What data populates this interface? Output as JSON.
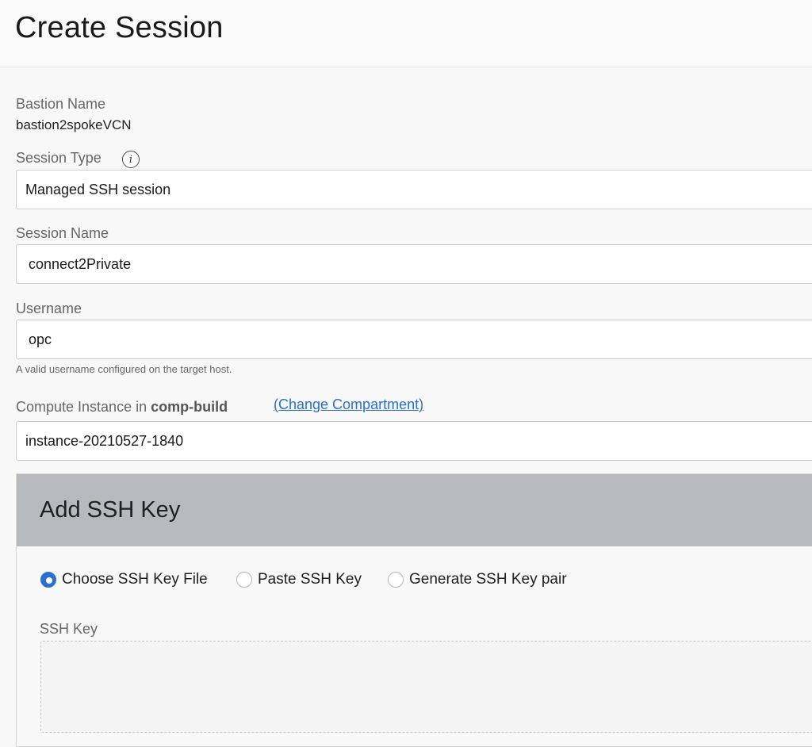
{
  "page": {
    "title": "Create Session"
  },
  "bastion": {
    "label": "Bastion Name",
    "value": "bastion2spokeVCN"
  },
  "session_type": {
    "label": "Session Type",
    "info_icon": "info-icon",
    "value": "Managed SSH session"
  },
  "session_name": {
    "label": "Session Name",
    "value": "connect2Private"
  },
  "username": {
    "label": "Username",
    "value": "opc",
    "helper": "A valid username configured on the target host."
  },
  "compute_instance": {
    "label_prefix": "Compute Instance in",
    "compartment": "comp-build",
    "change_link": "(Change Compartment)",
    "value": "instance-20210527-1840"
  },
  "ssh_panel": {
    "title": "Add SSH Key",
    "options": [
      {
        "label": "Choose SSH Key File",
        "selected": true
      },
      {
        "label": "Paste SSH Key",
        "selected": false
      },
      {
        "label": "Generate SSH Key pair",
        "selected": false
      }
    ],
    "key_label": "SSH Key"
  },
  "colors": {
    "accent": "#2b6fd1",
    "link": "#2a6fc9",
    "panel_header": "#b6b9be"
  }
}
